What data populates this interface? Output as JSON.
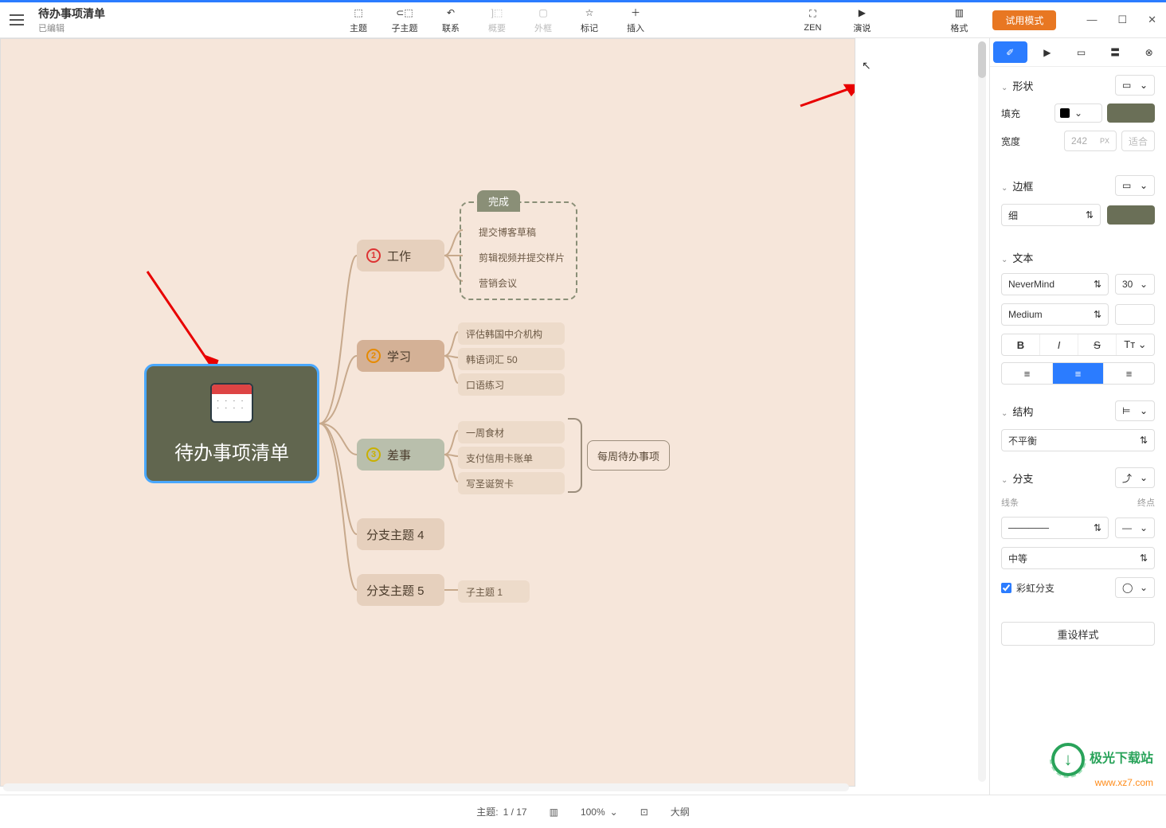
{
  "doc": {
    "title": "待办事项清单",
    "status": "已编辑"
  },
  "toolbar": {
    "items": [
      {
        "label": "主题",
        "ico": "□←"
      },
      {
        "label": "子主题",
        "ico": "⊂□"
      },
      {
        "label": "联系",
        "ico": "↶"
      },
      {
        "label": "概要",
        "ico": "]□",
        "dim": true
      },
      {
        "label": "外框",
        "ico": "▢",
        "dim": true
      },
      {
        "label": "标记",
        "ico": "☆"
      },
      {
        "label": "插入",
        "ico": "＋▾"
      }
    ],
    "right": [
      {
        "label": "ZEN",
        "ico": "⛶"
      },
      {
        "label": "演说",
        "ico": "▶"
      },
      {
        "label": "格式",
        "ico": "▥"
      }
    ],
    "trial": "试用模式"
  },
  "mindmap": {
    "root": "待办事项清单",
    "boundary": "完成",
    "branches": [
      {
        "label": "工作",
        "children": [
          "提交博客草稿",
          "剪辑视频并提交样片",
          "营销会议"
        ]
      },
      {
        "label": "学习",
        "children": [
          "评估韩国中介机构",
          "韩语词汇 50",
          "口语练习"
        ]
      },
      {
        "label": "差事",
        "children": [
          "一周食材",
          "支付信用卡账单",
          "写圣诞贺卡"
        ]
      },
      {
        "label": "分支主题 4",
        "children": []
      },
      {
        "label": "分支主题 5",
        "children": [
          "子主题 1"
        ]
      }
    ],
    "summary": "每周待办事项"
  },
  "panel": {
    "shape": {
      "title": "形状",
      "fill": "填充",
      "fill_color": "#000000",
      "width_lbl": "宽度",
      "width_val": "242",
      "width_unit": "PX",
      "fit": "适合"
    },
    "border": {
      "title": "边框",
      "weight": "细"
    },
    "text": {
      "title": "文本",
      "font": "NeverMind",
      "size": "30",
      "weight": "Medium"
    },
    "struct": {
      "title": "结构",
      "balance": "不平衡"
    },
    "branch": {
      "title": "分支",
      "line_lbl": "线条",
      "end_lbl": "终点",
      "weight": "中等",
      "rainbow": "彩虹分支"
    },
    "reset": "重设样式"
  },
  "status": {
    "topic_lbl": "主题:",
    "topic_val": "1 / 17",
    "zoom": "100%",
    "outline": "大纲"
  },
  "watermark": {
    "name": "极光下载站",
    "url": "www.xz7.com"
  }
}
